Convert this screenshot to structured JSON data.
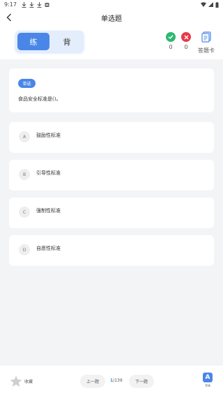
{
  "status_bar": {
    "time": "9:17"
  },
  "nav": {
    "title": "单选题"
  },
  "mode_toggle": {
    "practice_label": "练",
    "memorize_label": "背"
  },
  "stats": {
    "correct_count": "0",
    "wrong_count": "0",
    "answer_card_label": "答题卡"
  },
  "question": {
    "type_badge": "单选",
    "text": "食品安全标准是()。"
  },
  "options": [
    {
      "letter": "A",
      "text": "鼓励性标准"
    },
    {
      "letter": "B",
      "text": "引导性标准"
    },
    {
      "letter": "C",
      "text": "强制性标准"
    },
    {
      "letter": "D",
      "text": "自愿性标准"
    }
  ],
  "bottom_bar": {
    "favorite_label": "收藏",
    "prev_label": "上一题",
    "current_page": "1",
    "total_pages": "/139",
    "next_label": "下一题",
    "font_label": "字体",
    "font_icon_text": "A"
  },
  "colors": {
    "accent": "#4a86e8",
    "correct": "#2eb872",
    "wrong": "#e8394a"
  }
}
